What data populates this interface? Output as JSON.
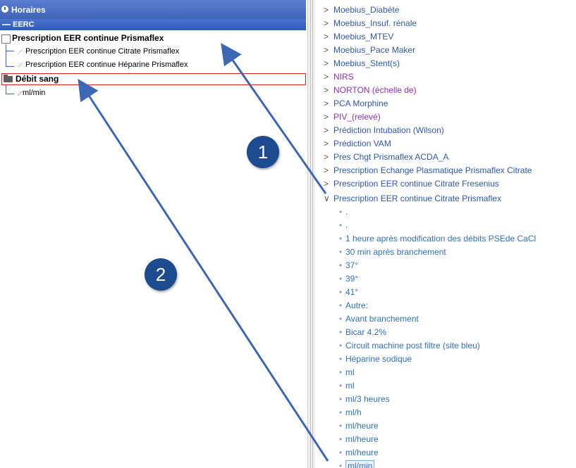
{
  "left_panel": {
    "header": "Horaires",
    "subheader": "EERC",
    "group_title": "Prescription EER continue Prismaflex",
    "group_items": [
      "Prescription EER continue Citrate Prismaflex",
      "Prescription EER continue Héparine Prismaflex"
    ],
    "debit_title": "Débit sang",
    "debit_item": "ml/min"
  },
  "right_panel": {
    "tree_items": [
      {
        "label": "Moebius_Diabète",
        "color": "blue"
      },
      {
        "label": "Moebius_Insuf. rénale",
        "color": "blue"
      },
      {
        "label": "Moebius_MTEV",
        "color": "blue"
      },
      {
        "label": "Moebius_Pace Maker",
        "color": "blue"
      },
      {
        "label": "Moebius_Stent(s)",
        "color": "blue"
      },
      {
        "label": "NIRS",
        "color": "purple"
      },
      {
        "label": "NORTON (échelle de)",
        "color": "purple"
      },
      {
        "label": "PCA Morphine",
        "color": "blue"
      },
      {
        "label": "PIV_(relevé)",
        "color": "purple"
      },
      {
        "label": "Prédiction Intubation (Wilson)",
        "color": "blue"
      },
      {
        "label": "Prédiction VAM",
        "color": "blue"
      },
      {
        "label": "Pres Chgt Prismaflex ACDA_A",
        "color": "blue"
      },
      {
        "label": "Prescription Echange Plasmatique Prismaflex Citrate",
        "color": "blue"
      },
      {
        "label": "Prescription EER continue Citrate Fresenius",
        "color": "blue"
      }
    ],
    "expanded_item": "Prescription EER continue Citrate Prismaflex",
    "leaves": [
      ".",
      ".",
      "1 heure après modification des débits PSEde CaCl",
      "30 min après branchement",
      "37°",
      "39°",
      "41°",
      "Autre:",
      "Avant branchement",
      "Bicar 4.2%",
      "Circuit machine post filtre (site bleu)",
      "Héparine sodique",
      "ml",
      "ml",
      "ml/3 heures",
      "ml/h",
      "ml/heure",
      "ml/heure",
      "ml/heure",
      "ml/min"
    ],
    "selected_leaf_index": 19
  },
  "annotations": {
    "marker_1": "1",
    "marker_2": "2"
  },
  "colors": {
    "header_blue": "#3f63b8",
    "tree_blue": "#2f57b0",
    "tree_purple": "#8d2fb4",
    "leaf_blue": "#2f6fc4",
    "highlight_red": "#e02020",
    "marker_navy": "#1c4c8f"
  }
}
